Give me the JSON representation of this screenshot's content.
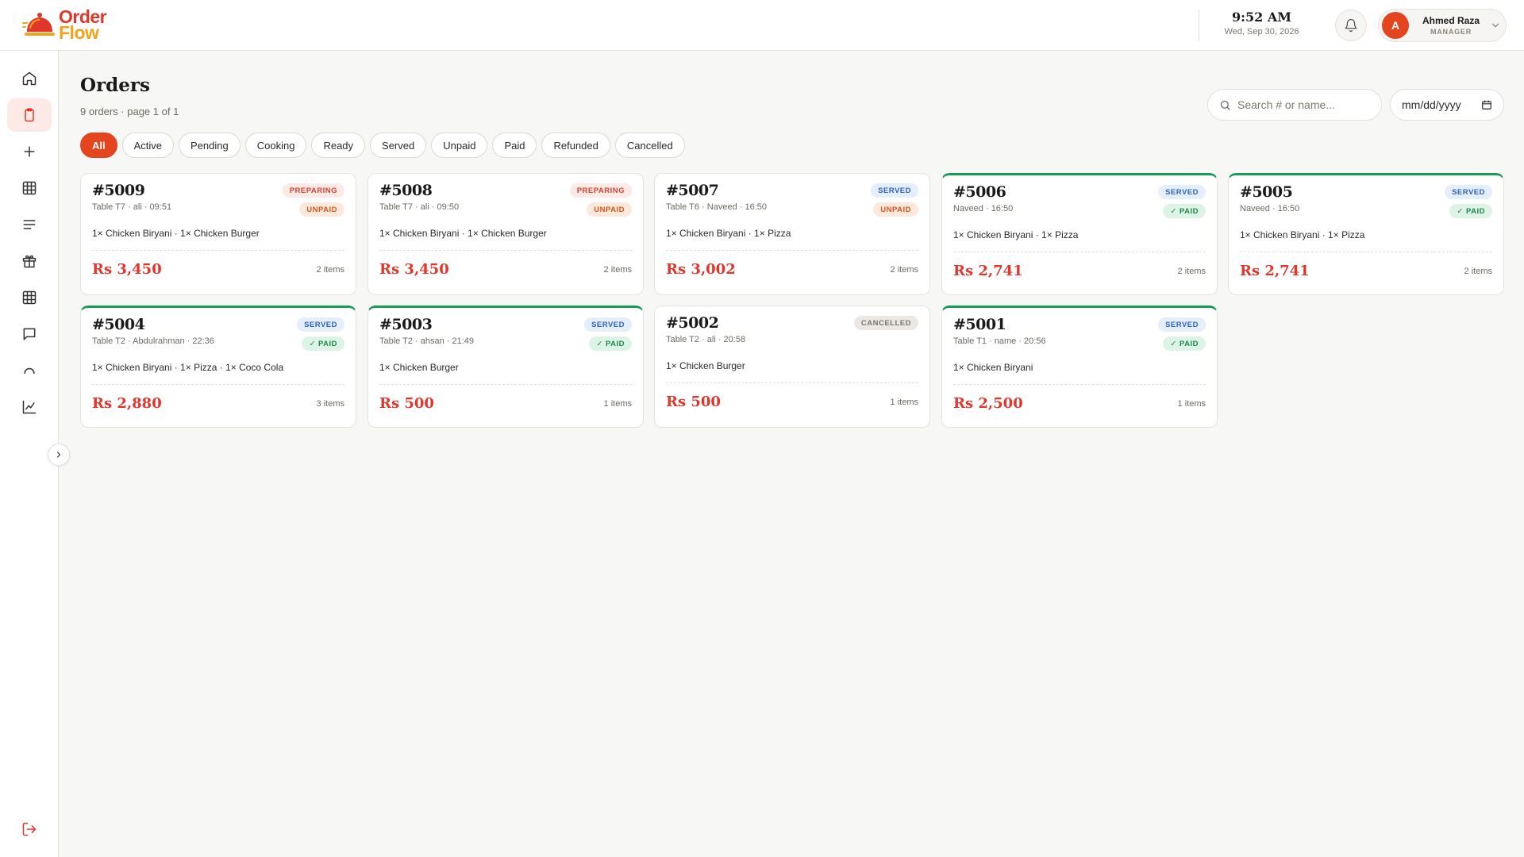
{
  "brand": {
    "line1": "Order",
    "line2": "Flow"
  },
  "header": {
    "time": "9:52 AM",
    "date": "Wed, Sep 30, 2026",
    "user_initial": "A",
    "user_name": "Ahmed Raza",
    "user_role": "MANAGER"
  },
  "sidebar": {
    "items": [
      {
        "name": "home-icon",
        "active": false
      },
      {
        "name": "clipboard-icon",
        "active": true
      },
      {
        "name": "plus-icon",
        "active": false
      },
      {
        "name": "grid-table-icon",
        "active": false
      },
      {
        "name": "menu-list-icon",
        "active": false
      },
      {
        "name": "gift-icon",
        "active": false
      },
      {
        "name": "grid-icon",
        "active": false
      },
      {
        "name": "chat-icon",
        "active": false
      },
      {
        "name": "cloche-icon",
        "active": false
      },
      {
        "name": "chart-icon",
        "active": false
      }
    ]
  },
  "page": {
    "title": "Orders",
    "subtitle": "9 orders · page 1 of 1",
    "search_placeholder": "Search # or name...",
    "date_placeholder": "mm/dd/yyyy"
  },
  "filters": [
    "All",
    "Active",
    "Pending",
    "Cooking",
    "Ready",
    "Served",
    "Unpaid",
    "Paid",
    "Refunded",
    "Cancelled"
  ],
  "active_filter": "All",
  "orders": [
    {
      "number": "#5009",
      "meta": "Table T7 · ali · 09:51",
      "items": "1× Chicken Biryani · 1× Chicken Burger",
      "total": "Rs 3,450",
      "count": "2 items",
      "status": "PREPARING",
      "payment": "UNPAID"
    },
    {
      "number": "#5008",
      "meta": "Table T7 · ali · 09:50",
      "items": "1× Chicken Biryani · 1× Chicken Burger",
      "total": "Rs 3,450",
      "count": "2 items",
      "status": "PREPARING",
      "payment": "UNPAID"
    },
    {
      "number": "#5007",
      "meta": "Table T6 · Naveed · 16:50",
      "items": "1× Chicken Biryani · 1× Pizza",
      "total": "Rs 3,002",
      "count": "2 items",
      "status": "SERVED",
      "payment": "UNPAID"
    },
    {
      "number": "#5006",
      "meta": "Naveed · 16:50",
      "items": "1× Chicken Biryani · 1× Pizza",
      "total": "Rs 2,741",
      "count": "2 items",
      "status": "SERVED",
      "payment": "✓ PAID"
    },
    {
      "number": "#5005",
      "meta": "Naveed · 16:50",
      "items": "1× Chicken Biryani · 1× Pizza",
      "total": "Rs 2,741",
      "count": "2 items",
      "status": "SERVED",
      "payment": "✓ PAID"
    },
    {
      "number": "#5004",
      "meta": "Table T2 · Abdulrahman · 22:36",
      "items": "1× Chicken Biryani · 1× Pizza · 1× Coco Cola",
      "total": "Rs 2,880",
      "count": "3 items",
      "status": "SERVED",
      "payment": "✓ PAID"
    },
    {
      "number": "#5003",
      "meta": "Table T2 · ahsan · 21:49",
      "items": "1× Chicken Burger",
      "total": "Rs 500",
      "count": "1 items",
      "status": "SERVED",
      "payment": "✓ PAID"
    },
    {
      "number": "#5002",
      "meta": "Table T2 · ali · 20:58",
      "items": "1× Chicken Burger",
      "total": "Rs 500",
      "count": "1 items",
      "status": "CANCELLED",
      "payment": ""
    },
    {
      "number": "#5001",
      "meta": "Table T1 · name · 20:56",
      "items": "1× Chicken Biryani",
      "total": "Rs 2,500",
      "count": "1 items",
      "status": "SERVED",
      "payment": "✓ PAID"
    }
  ],
  "colors": {
    "accent": "#e4451f",
    "price": "#e0362b",
    "paid_border": "#1a9b55"
  }
}
